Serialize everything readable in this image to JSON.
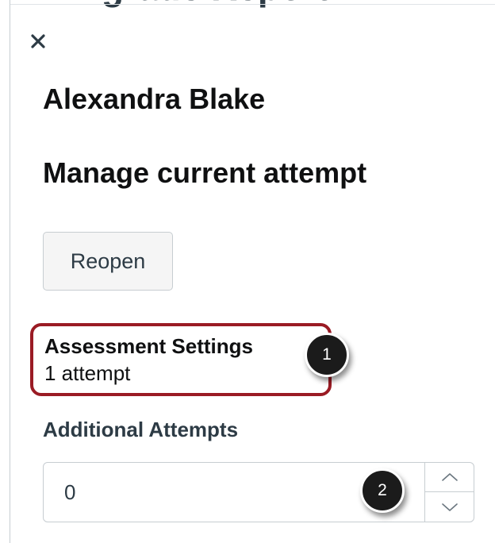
{
  "header": {
    "cropped_title": "grade Report"
  },
  "panel": {
    "student_name": "Alexandra Blake",
    "section_title": "Manage current attempt",
    "reopen_label": "Reopen",
    "assessment_settings": {
      "label": "Assessment Settings",
      "value": "1 attempt"
    },
    "additional_attempts": {
      "label": "Additional Attempts",
      "value": "0"
    }
  },
  "callouts": [
    "1",
    "2"
  ],
  "icons": {
    "close": "close-icon",
    "increment": "chevron-up-icon",
    "decrement": "chevron-down-icon"
  },
  "colors": {
    "highlight": "#9a1b24",
    "callout_bg": "#1b1b1b",
    "button_bg": "#f5f5f5",
    "border": "#c7cdd1",
    "label_text": "#2d3b45"
  }
}
